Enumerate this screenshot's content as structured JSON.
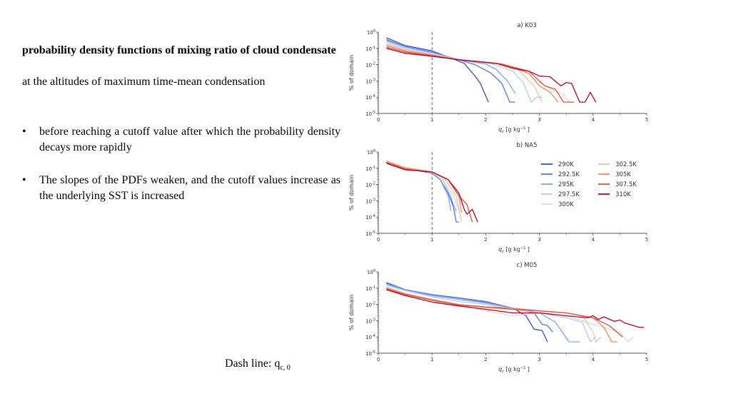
{
  "text": {
    "heading": "probability density functions of mixing ratio of cloud condensate",
    "subheading": "at the altitudes of maximum time-mean condensation",
    "bullets": [
      "before reaching a cutoff value after which the probability density decays more rapidly",
      "The slopes of the PDFs weaken, and the cutoff values increase as the underlying SST is increased"
    ],
    "bullet_symbol": "•",
    "dash_note_main": "Dash line: q",
    "dash_note_sub": "c, 0"
  },
  "chart_data": [
    {
      "type": "line",
      "title": "a) K03",
      "xlabel": "q_c [g kg^-1]",
      "ylabel": "% of domain",
      "xlim": [
        0,
        5
      ],
      "ylim_log10": [
        -5,
        0
      ],
      "xticks": [
        "0",
        "1",
        "2",
        "3",
        "4",
        "5"
      ],
      "yticks": [
        "10^0",
        "10^-1",
        "10^-2",
        "10^-3",
        "10^-4",
        "10^-5"
      ],
      "dashed_vline_x": 1,
      "series": [
        {
          "name": "290K",
          "color": "#3b4cc0",
          "x": [
            0.15,
            0.5,
            1.0,
            1.3,
            1.6,
            1.8,
            1.9,
            2.05
          ],
          "y": [
            0.45,
            0.15,
            0.07,
            0.03,
            0.012,
            0.002,
            0.0007,
            5e-05
          ]
        },
        {
          "name": "292.5K",
          "color": "#5a78e0",
          "x": [
            0.15,
            0.5,
            1.0,
            1.5,
            1.8,
            2.1,
            2.3,
            2.45,
            2.55
          ],
          "y": [
            0.35,
            0.13,
            0.06,
            0.02,
            0.01,
            0.003,
            0.0007,
            5e-05,
            5e-05
          ]
        },
        {
          "name": "295K",
          "color": "#82a6f5",
          "x": [
            0.15,
            0.5,
            1.0,
            1.5,
            2.0,
            2.2,
            2.4,
            2.55
          ],
          "y": [
            0.3,
            0.12,
            0.055,
            0.02,
            0.011,
            0.005,
            0.001,
            0.00017
          ]
        },
        {
          "name": "297.5K",
          "color": "#b4cdf5",
          "x": [
            0.15,
            0.5,
            1.0,
            1.5,
            2.1,
            2.5,
            2.7,
            2.85,
            2.95,
            3.05
          ],
          "y": [
            0.25,
            0.1,
            0.05,
            0.02,
            0.012,
            0.004,
            0.0008,
            5e-05,
            0.0001,
            0.0001
          ]
        },
        {
          "name": "300K",
          "color": "#dddcdc",
          "x": [
            0.15,
            0.5,
            1.0,
            1.5,
            2.2,
            2.7,
            3.0,
            3.3,
            3.45,
            3.55
          ],
          "y": [
            0.2,
            0.09,
            0.045,
            0.02,
            0.012,
            0.004,
            0.0008,
            0.0002,
            0.00015,
            5e-05
          ]
        },
        {
          "name": "302.5K",
          "color": "#f5c1a7",
          "x": [
            0.15,
            0.5,
            1.0,
            1.5,
            2.2,
            2.6,
            2.9,
            3.05
          ],
          "y": [
            0.18,
            0.08,
            0.04,
            0.02,
            0.012,
            0.005,
            0.0005,
            5e-05
          ]
        },
        {
          "name": "305K",
          "color": "#ee8a6a",
          "x": [
            0.15,
            0.5,
            1.0,
            1.5,
            2.3,
            2.8,
            3.0,
            3.2,
            3.35
          ],
          "y": [
            0.15,
            0.07,
            0.04,
            0.02,
            0.011,
            0.003,
            0.0005,
            0.0002,
            5e-05
          ]
        },
        {
          "name": "307.5K",
          "color": "#d4553f",
          "x": [
            0.15,
            0.5,
            1.0,
            1.5,
            2.3,
            2.8,
            3.1,
            3.3,
            3.45,
            3.65
          ],
          "y": [
            0.12,
            0.06,
            0.035,
            0.02,
            0.011,
            0.004,
            0.0005,
            0.0003,
            5e-05,
            5e-05
          ]
        },
        {
          "name": "310K",
          "color": "#b40426",
          "x": [
            0.15,
            0.5,
            1.0,
            1.5,
            2.2,
            2.5,
            2.8,
            3.0,
            3.2,
            3.4,
            3.5,
            3.6,
            3.75,
            3.85,
            3.95,
            4.05
          ],
          "y": [
            0.1,
            0.05,
            0.033,
            0.02,
            0.012,
            0.006,
            0.004,
            0.002,
            0.0018,
            0.0005,
            0.0008,
            0.0007,
            5e-05,
            5e-05,
            0.0002,
            5e-05
          ]
        }
      ]
    },
    {
      "type": "line",
      "title": "b) NA5",
      "xlabel": "q_c [g kg^-1]",
      "ylabel": "% of domain",
      "xlim": [
        0,
        5
      ],
      "ylim_log10": [
        -5,
        0
      ],
      "xticks": [
        "0",
        "1",
        "2",
        "3",
        "4",
        "5"
      ],
      "yticks": [
        "10^0",
        "10^-1",
        "10^-2",
        "10^-3",
        "10^-4",
        "10^-5"
      ],
      "dashed_vline_x": 1,
      "legend": {
        "placement": "top-right",
        "columns": 2
      },
      "series": [
        {
          "name": "290K",
          "color": "#3b4cc0",
          "x": [
            0.15,
            0.5,
            1.0,
            1.15,
            1.3,
            1.4,
            1.45
          ],
          "y": [
            0.25,
            0.1,
            0.05,
            0.02,
            0.003,
            0.0005,
            0.00025
          ]
        },
        {
          "name": "292.5K",
          "color": "#5a78e0",
          "x": [
            0.15,
            0.5,
            1.0,
            1.15,
            1.3,
            1.4,
            1.45,
            1.5
          ],
          "y": [
            0.25,
            0.1,
            0.05,
            0.02,
            0.003,
            0.0004,
            5e-05,
            5e-05
          ]
        },
        {
          "name": "295K",
          "color": "#82a6f5",
          "x": [
            0.15,
            0.5,
            1.0,
            1.15,
            1.3,
            1.35
          ],
          "y": [
            0.27,
            0.11,
            0.055,
            0.02,
            0.002,
            0.00025
          ]
        },
        {
          "name": "297.5K",
          "color": "#b4cdf5",
          "x": [
            0.15,
            0.5,
            1.0,
            1.2,
            1.35,
            1.45
          ],
          "y": [
            0.28,
            0.11,
            0.055,
            0.02,
            0.002,
            0.0002
          ]
        },
        {
          "name": "300K",
          "color": "#dddcdc",
          "x": [
            0.15,
            0.5,
            1.0,
            1.2,
            1.4,
            1.5
          ],
          "y": [
            0.3,
            0.12,
            0.06,
            0.02,
            0.002,
            0.00025
          ]
        },
        {
          "name": "302.5K",
          "color": "#f5c1a7",
          "x": [
            0.15,
            0.5,
            1.0,
            1.25,
            1.45,
            1.55
          ],
          "y": [
            0.28,
            0.11,
            0.06,
            0.02,
            0.002,
            5e-05
          ]
        },
        {
          "name": "305K",
          "color": "#ee8a6a",
          "x": [
            0.15,
            0.5,
            1.0,
            1.3,
            1.5,
            1.55
          ],
          "y": [
            0.25,
            0.1,
            0.06,
            0.02,
            0.002,
            0.0002
          ]
        },
        {
          "name": "307.5K",
          "color": "#d4553f",
          "x": [
            0.15,
            0.5,
            1.0,
            1.3,
            1.5,
            1.65,
            1.75
          ],
          "y": [
            0.22,
            0.09,
            0.06,
            0.02,
            0.002,
            0.0006,
            5e-05
          ]
        },
        {
          "name": "310K",
          "color": "#b40426",
          "x": [
            0.15,
            0.5,
            1.0,
            1.3,
            1.5,
            1.6,
            1.65,
            1.75,
            1.85
          ],
          "y": [
            0.2,
            0.08,
            0.06,
            0.02,
            0.003,
            0.0003,
            0.00015,
            0.0003,
            5e-05
          ]
        }
      ]
    },
    {
      "type": "line",
      "title": "c) M05",
      "xlabel": "q_c [g kg^-1]",
      "ylabel": "% of domain",
      "xlim": [
        0,
        5
      ],
      "ylim_log10": [
        -5,
        0
      ],
      "xticks": [
        "0",
        "1",
        "2",
        "3",
        "4",
        "5"
      ],
      "yticks": [
        "10^0",
        "10^-1",
        "10^-2",
        "10^-3",
        "10^-4",
        "10^-5"
      ],
      "series": [
        {
          "name": "290K",
          "color": "#3b4cc0",
          "x": [
            0.15,
            0.5,
            1.0,
            1.5,
            2.0,
            2.5,
            2.75,
            2.9,
            3.05,
            3.15
          ],
          "y": [
            0.22,
            0.08,
            0.04,
            0.025,
            0.015,
            0.006,
            0.002,
            0.0003,
            0.00025,
            5e-05
          ]
        },
        {
          "name": "292.5K",
          "color": "#5a78e0",
          "x": [
            0.15,
            0.5,
            1.0,
            1.5,
            2.0,
            2.5,
            2.9,
            3.05,
            3.15,
            3.25
          ],
          "y": [
            0.2,
            0.08,
            0.04,
            0.024,
            0.014,
            0.006,
            0.003,
            0.0006,
            0.0005,
            0.0002
          ]
        },
        {
          "name": "295K",
          "color": "#82a6f5",
          "x": [
            0.15,
            0.5,
            1.0,
            1.5,
            2.0,
            2.5,
            3.0,
            3.3,
            3.55,
            3.75
          ],
          "y": [
            0.18,
            0.075,
            0.035,
            0.02,
            0.012,
            0.006,
            0.003,
            0.0008,
            5e-05,
            5e-05
          ]
        },
        {
          "name": "297.5K",
          "color": "#b4cdf5",
          "x": [
            0.15,
            0.5,
            1.0,
            1.5,
            2.0,
            2.5,
            3.0,
            3.5,
            3.8,
            3.95,
            4.05
          ],
          "y": [
            0.15,
            0.07,
            0.03,
            0.015,
            0.01,
            0.005,
            0.003,
            0.0015,
            0.0008,
            5e-05,
            0.0001
          ]
        },
        {
          "name": "300K",
          "color": "#dddcdc",
          "x": [
            0.15,
            0.5,
            1.0,
            1.5,
            2.0,
            2.5,
            3.0,
            3.5,
            4.0,
            4.3,
            4.5,
            4.65,
            4.75
          ],
          "y": [
            0.12,
            0.05,
            0.02,
            0.01,
            0.004,
            0.002,
            0.003,
            0.002,
            0.0006,
            0.0003,
            0.0002,
            5e-05,
            0.0001
          ]
        },
        {
          "name": "302.5K",
          "color": "#f5c1a7",
          "x": [
            0.15,
            0.5,
            1.0,
            1.5,
            2.0,
            2.5,
            3.0,
            3.5,
            3.8,
            4.0,
            4.05,
            4.15
          ],
          "y": [
            0.11,
            0.045,
            0.02,
            0.01,
            0.006,
            0.005,
            0.004,
            0.003,
            0.002,
            0.0002,
            5e-05,
            0.0001
          ]
        },
        {
          "name": "305K",
          "color": "#ee8a6a",
          "x": [
            0.15,
            0.5,
            1.0,
            1.5,
            2.0,
            2.5,
            3.0,
            3.5,
            4.0,
            4.2,
            4.35,
            4.45
          ],
          "y": [
            0.1,
            0.045,
            0.02,
            0.01,
            0.007,
            0.006,
            0.004,
            0.003,
            0.0015,
            0.0004,
            5e-05,
            5e-05
          ]
        },
        {
          "name": "307.5K",
          "color": "#d4553f",
          "x": [
            0.15,
            0.5,
            1.0,
            1.5,
            2.0,
            2.5,
            3.0,
            3.5,
            4.0,
            4.3,
            4.55
          ],
          "y": [
            0.09,
            0.04,
            0.018,
            0.009,
            0.007,
            0.005,
            0.004,
            0.003,
            0.0015,
            0.0005,
            0.0001
          ]
        },
        {
          "name": "310K",
          "color": "#b40426",
          "x": [
            0.15,
            0.5,
            1.0,
            1.5,
            2.0,
            2.5,
            3.0,
            3.5,
            3.9,
            4.0,
            4.1,
            4.2,
            4.4,
            4.5,
            4.6,
            4.85,
            4.95
          ],
          "y": [
            0.08,
            0.035,
            0.014,
            0.008,
            0.005,
            0.003,
            0.003,
            0.002,
            0.0015,
            0.002,
            0.0012,
            0.0017,
            0.0009,
            0.0011,
            0.0007,
            0.0004,
            0.00038
          ]
        }
      ]
    }
  ]
}
